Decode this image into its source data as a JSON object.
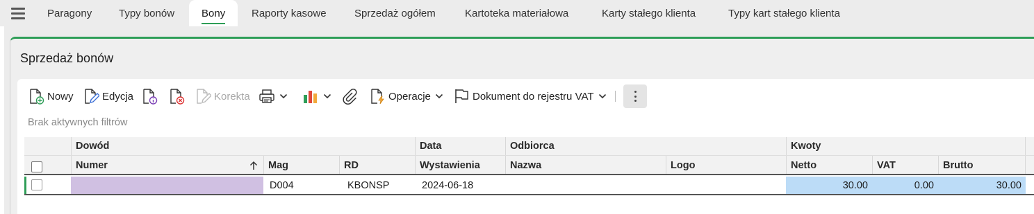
{
  "nav": {
    "tabs": [
      {
        "label": "Paragony"
      },
      {
        "label": "Typy bonów"
      },
      {
        "label": "Bony"
      },
      {
        "label": "Raporty kasowe"
      },
      {
        "label": "Sprzedaż ogółem"
      },
      {
        "label": "Kartoteka materiałowa"
      },
      {
        "label": "Karty stałego klienta"
      },
      {
        "label": "Typy kart stałego klienta"
      }
    ],
    "active_tab": "Bony",
    "accent_color": "#2e9e57"
  },
  "panel": {
    "title": "Sprzedaż bonów"
  },
  "toolbar": {
    "new_label": "Nowy",
    "edit_label": "Edycja",
    "correction_label": "Korekta",
    "operations_label": "Operacje",
    "vat_register_label": "Dokument do rejestru VAT",
    "icons": [
      "new-document-icon",
      "edit-icon",
      "document-info-icon",
      "document-delete-icon",
      "correction-icon",
      "print-icon",
      "chart-icon",
      "attachment-icon",
      "operations-icon",
      "flag-icon",
      "more-vertical-icon"
    ]
  },
  "filters": {
    "status_text": "Brak aktywnych filtrów"
  },
  "grid": {
    "group_headers": {
      "dowod": "Dowód",
      "data": "Data",
      "odbiorca": "Odbiorca",
      "kwoty": "Kwoty"
    },
    "columns": {
      "numer": "Numer",
      "mag": "Mag",
      "rd": "RD",
      "wystawienia": "Wystawienia",
      "nazwa": "Nazwa",
      "logo": "Logo",
      "netto": "Netto",
      "vat": "VAT",
      "brutto": "Brutto"
    },
    "rows": [
      {
        "numer": "",
        "mag": "D004",
        "rd": "KBONSP",
        "wystawienia": "2024-06-18",
        "nazwa": "",
        "logo": "",
        "netto": "30.00",
        "vat": "0.00",
        "brutto": "30.00"
      }
    ]
  }
}
